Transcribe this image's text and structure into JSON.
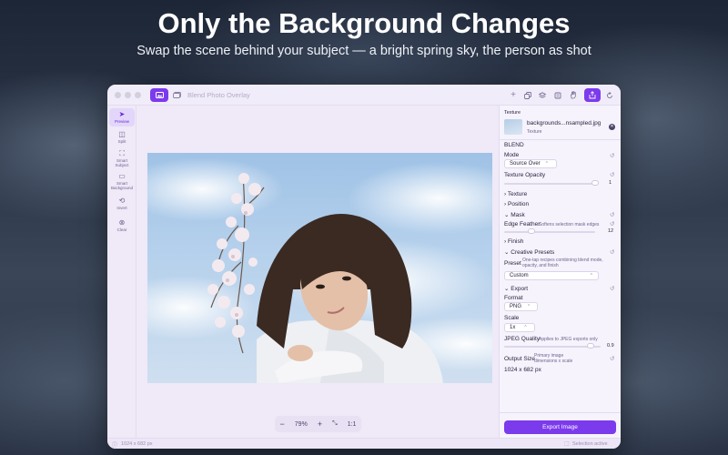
{
  "hero": {
    "title": "Only the Background Changes",
    "subtitle": "Swap the scene behind your subject — a bright spring sky, the person as shot"
  },
  "window": {
    "app_title": "Blend Photo Overlay",
    "toolbar_left": [
      {
        "icon": "photo-icon",
        "active": true
      },
      {
        "icon": "photos-stack-icon",
        "active": false
      }
    ],
    "toolbar_right": [
      {
        "icon": "plus-icon",
        "active": false
      },
      {
        "icon": "duplicate-icon",
        "active": false
      },
      {
        "icon": "layers-icon",
        "active": false
      },
      {
        "icon": "crop-icon",
        "active": false
      },
      {
        "icon": "hand-icon",
        "active": false
      },
      {
        "icon": "share-icon",
        "active": true
      },
      {
        "icon": "refresh-icon",
        "active": false
      }
    ]
  },
  "tools": [
    {
      "label": "Preview",
      "icon": "cursor-icon",
      "active": true
    },
    {
      "label": "Split",
      "icon": "split-icon",
      "active": false
    },
    {
      "label": "Smart Subject",
      "icon": "smart-subject-icon",
      "active": false
    },
    {
      "label": "Smart Background",
      "icon": "smart-background-icon",
      "active": false
    },
    {
      "label": "Invert",
      "icon": "invert-icon",
      "active": false
    },
    {
      "label": "Clear",
      "icon": "clear-icon",
      "active": false
    }
  ],
  "zoom": {
    "zoom_out": "−",
    "value": "79%",
    "zoom_in": "+",
    "fit": "⤡",
    "actual": "1:1"
  },
  "status": {
    "dimensions": "1024 x 682 px",
    "selection": "Selection active"
  },
  "panel": {
    "texture_heading": "Texture",
    "texture_file": "backgrounds...nsampled.jpg",
    "texture_caption": "Texture",
    "blend_heading": "BLEND",
    "mode_label": "Mode",
    "mode_value": "Source Over",
    "opacity_label": "Texture Opacity",
    "opacity_value": "1",
    "opacity_level": 1.0,
    "section_texture": "Texture",
    "section_position": "Position",
    "section_mask": "Mask",
    "feather_label": "Edge Feather",
    "feather_hint": "Softens selection mask edges",
    "feather_value": "12",
    "feather_level": 0.3,
    "section_finish": "Finish",
    "section_presets": "Creative Presets",
    "preset_label": "Preset",
    "preset_hint": "One-tap recipes combining blend mode, opacity, and finish",
    "preset_value": "Custom",
    "section_export": "Export",
    "format_label": "Format",
    "format_value": "PNG",
    "scale_label": "Scale",
    "scale_value": "1x",
    "jpeg_label": "JPEG Quality",
    "jpeg_hint": "Applies to JPEG exports only",
    "jpeg_value": "0.9",
    "jpeg_level": 0.9,
    "output_label": "Output Size",
    "output_hint": "Primary image dimensions x scale",
    "output_value": "1024 x 682 px",
    "export_button": "Export Image"
  },
  "colors": {
    "accent": "#7c3aed",
    "window_bg": "#f4f0fb",
    "sky_top": "#9fc2e6"
  }
}
